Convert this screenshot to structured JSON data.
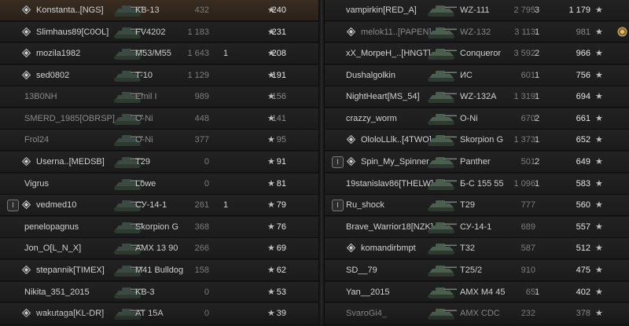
{
  "colors": {
    "highlight_row": "#3a2d22",
    "row_bg": "#1f1f1f",
    "text": "#d2d2d2",
    "muted": "#7d7d7d",
    "divider": "#2a2a2a"
  },
  "icons": {
    "rank": "rank-badge-icon",
    "platoon": "platoon-icon",
    "star": "star-icon",
    "tank": "tank-silhouette-icon",
    "medal": "medal-icon"
  },
  "left_team": [
    {
      "name": "Konstanta..[NGS]",
      "tank": "KB-13",
      "battles": "432",
      "kills": "",
      "score": "240",
      "rank": true,
      "platoon": "",
      "highlight": true
    },
    {
      "name": "Slimhaus89[C0OL]",
      "tank": "FV4202",
      "battles": "1 183",
      "kills": "",
      "score": "231",
      "rank": true,
      "platoon": ""
    },
    {
      "name": "mozila1982",
      "tank": "M53/M55",
      "battles": "1 643",
      "kills": "1",
      "score": "208",
      "rank": true,
      "platoon": ""
    },
    {
      "name": "sed0802",
      "tank": "T-10",
      "battles": "1 129",
      "kills": "",
      "score": "191",
      "rank": true,
      "platoon": ""
    },
    {
      "name": "13B0NH",
      "tank": "Emil I",
      "battles": "989",
      "kills": "",
      "score": "156",
      "rank": false,
      "platoon": "",
      "dim": true
    },
    {
      "name": "SMERD_1985[OBRSP]",
      "tank": "O-Ni",
      "battles": "448",
      "kills": "",
      "score": "141",
      "rank": false,
      "platoon": "",
      "dim": true
    },
    {
      "name": "Frol24",
      "tank": "O-Ni",
      "battles": "377",
      "kills": "",
      "score": "95",
      "rank": false,
      "platoon": "",
      "dim": true
    },
    {
      "name": "Userna..[MEDSB]",
      "tank": "T29",
      "battles": "0",
      "kills": "",
      "score": "91",
      "rank": true,
      "platoon": ""
    },
    {
      "name": "Vigrus",
      "tank": "Löwe",
      "battles": "0",
      "kills": "",
      "score": "81",
      "rank": false,
      "platoon": ""
    },
    {
      "name": "vedmed10",
      "tank": "СУ-14-1",
      "battles": "261",
      "kills": "1",
      "score": "79",
      "rank": true,
      "platoon": "I"
    },
    {
      "name": "penelopagnus",
      "tank": "Skorpion G",
      "battles": "368",
      "kills": "",
      "score": "76",
      "rank": false,
      "platoon": ""
    },
    {
      "name": "Jon_O[L_N_X]",
      "tank": "AMX 13 90",
      "battles": "266",
      "kills": "",
      "score": "69",
      "rank": false,
      "platoon": ""
    },
    {
      "name": "stepannik[TIMEX]",
      "tank": "M41 Bulldog",
      "battles": "158",
      "kills": "",
      "score": "62",
      "rank": true,
      "platoon": ""
    },
    {
      "name": "Nikita_351_2015",
      "tank": "KB-3",
      "battles": "0",
      "kills": "",
      "score": "53",
      "rank": false,
      "platoon": ""
    },
    {
      "name": "wakutaga[KL-DR]",
      "tank": "AT 15A",
      "battles": "0",
      "kills": "",
      "score": "39",
      "rank": true,
      "platoon": ""
    }
  ],
  "right_team": [
    {
      "name": "vampirkin[RED_A]",
      "tank": "WZ-111",
      "battles": "2 795",
      "kills": "3",
      "score": "1 179",
      "rank": false,
      "platoon": ""
    },
    {
      "name": "melok11..[PAPEN]",
      "tank": "WZ-132",
      "battles": "3 113",
      "kills": "1",
      "score": "981",
      "rank": true,
      "platoon": "",
      "dim": true,
      "medal": true
    },
    {
      "name": "xX_MorpeH_..[HNGT]",
      "tank": "Conqueror",
      "battles": "3 592",
      "kills": "2",
      "score": "966",
      "rank": false,
      "platoon": ""
    },
    {
      "name": "Dushalgolkin",
      "tank": "ИС",
      "battles": "601",
      "kills": "1",
      "score": "756",
      "rank": false,
      "platoon": ""
    },
    {
      "name": "NightHeart[MS_54]",
      "tank": "WZ-132A",
      "battles": "1 319",
      "kills": "1",
      "score": "694",
      "rank": false,
      "platoon": ""
    },
    {
      "name": "crazzy_worm",
      "tank": "O-Ni",
      "battles": "670",
      "kills": "2",
      "score": "661",
      "rank": false,
      "platoon": ""
    },
    {
      "name": "OloloLLlk..[4TWO]",
      "tank": "Skorpion G",
      "battles": "1 373",
      "kills": "1",
      "score": "652",
      "rank": true,
      "platoon": ""
    },
    {
      "name": "Spin_My_Spinner",
      "tank": "Panther",
      "battles": "501",
      "kills": "2",
      "score": "649",
      "rank": true,
      "platoon": "I"
    },
    {
      "name": "19stanislav86[THELW]",
      "tank": "Б-С 155 55",
      "battles": "1 096",
      "kills": "1",
      "score": "583",
      "rank": false,
      "platoon": ""
    },
    {
      "name": "Ru_shock",
      "tank": "T29",
      "battles": "777",
      "kills": "",
      "score": "560",
      "rank": false,
      "platoon": "I"
    },
    {
      "name": "Brave_Warrior18[NZK]",
      "tank": "СУ-14-1",
      "battles": "689",
      "kills": "",
      "score": "557",
      "rank": false,
      "platoon": ""
    },
    {
      "name": "komandirbmpt",
      "tank": "T32",
      "battles": "587",
      "kills": "",
      "score": "512",
      "rank": true,
      "platoon": ""
    },
    {
      "name": "SD__79",
      "tank": "T25/2",
      "battles": "910",
      "kills": "",
      "score": "475",
      "rank": false,
      "platoon": ""
    },
    {
      "name": "Yan__2015",
      "tank": "AMX M4 45",
      "battles": "65",
      "kills": "1",
      "score": "402",
      "rank": false,
      "platoon": ""
    },
    {
      "name": "SvaroGi4_",
      "tank": "AMX CDC",
      "battles": "232",
      "kills": "",
      "score": "378",
      "rank": false,
      "platoon": "",
      "dim": true
    }
  ]
}
